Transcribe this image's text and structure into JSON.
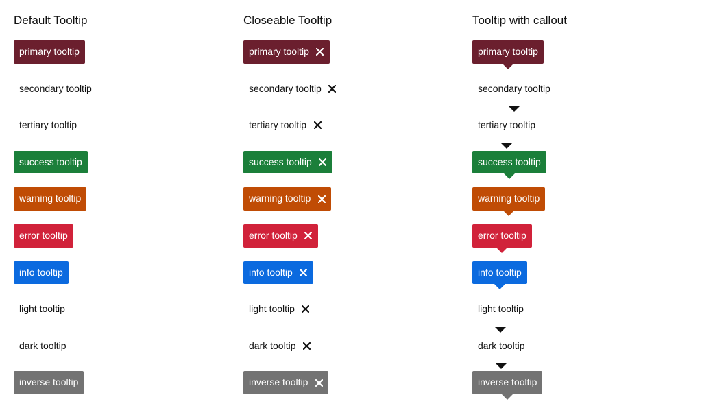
{
  "columns": [
    {
      "title": "Default Tooltip",
      "closeable": false,
      "callout": false
    },
    {
      "title": "Closeable Tooltip",
      "closeable": true,
      "callout": false
    },
    {
      "title": "Tooltip with callout",
      "closeable": false,
      "callout": true
    }
  ],
  "tooltips": [
    {
      "variant": "primary",
      "label": "primary tooltip",
      "background": "#6b1f2e",
      "text_color": "#ffffff"
    },
    {
      "variant": "secondary",
      "label": "secondary tooltip",
      "background": "transparent",
      "text_color": "#111111"
    },
    {
      "variant": "tertiary",
      "label": "tertiary tooltip",
      "background": "transparent",
      "text_color": "#111111"
    },
    {
      "variant": "success",
      "label": "success tooltip",
      "background": "#1b7f3a",
      "text_color": "#ffffff"
    },
    {
      "variant": "warning",
      "label": "warning tooltip",
      "background": "#c04c05",
      "text_color": "#ffffff"
    },
    {
      "variant": "error",
      "label": "error tooltip",
      "background": "#d1223a",
      "text_color": "#ffffff"
    },
    {
      "variant": "info",
      "label": "info tooltip",
      "background": "#0b6adf",
      "text_color": "#ffffff"
    },
    {
      "variant": "light",
      "label": "light tooltip",
      "background": "transparent",
      "text_color": "#111111"
    },
    {
      "variant": "dark",
      "label": "dark tooltip",
      "background": "transparent",
      "text_color": "#111111"
    },
    {
      "variant": "inverse",
      "label": "inverse tooltip",
      "background": "#737373",
      "text_color": "#ffffff"
    }
  ],
  "icons": {
    "close": "close-icon"
  }
}
